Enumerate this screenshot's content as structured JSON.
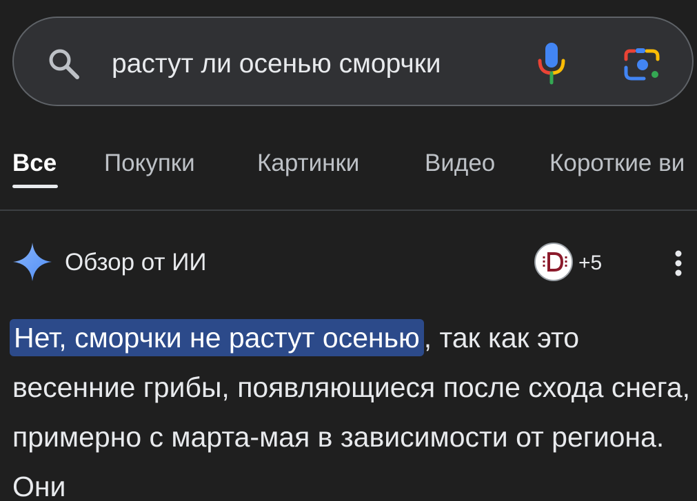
{
  "search": {
    "query": "растут ли осенью сморчки",
    "icons": {
      "search": "search-icon",
      "voice": "microphone-icon",
      "lens": "google-lens-icon"
    }
  },
  "tabs": [
    {
      "label": "Все",
      "active": true
    },
    {
      "label": "Покупки",
      "active": false
    },
    {
      "label": "Картинки",
      "active": false
    },
    {
      "label": "Видео",
      "active": false
    },
    {
      "label": "Короткие ви",
      "active": false
    }
  ],
  "ai_overview": {
    "title": "Обзор от ИИ",
    "sources_more": "+5",
    "answer_highlight": "Нет, сморчки не растут осенью",
    "answer_rest": ", так как это весенние грибы, появляющиеся после схода снега, примерно с марта-мая в зависимости от региона. Они",
    "icons": {
      "sparkle": "sparkle-icon",
      "source": "source-avatar",
      "more": "more-vert-icon"
    }
  },
  "colors": {
    "background": "#1f1f1f",
    "search_bg": "#303134",
    "highlight": "#2c4a8a",
    "sparkle": "#4e8ef7"
  }
}
